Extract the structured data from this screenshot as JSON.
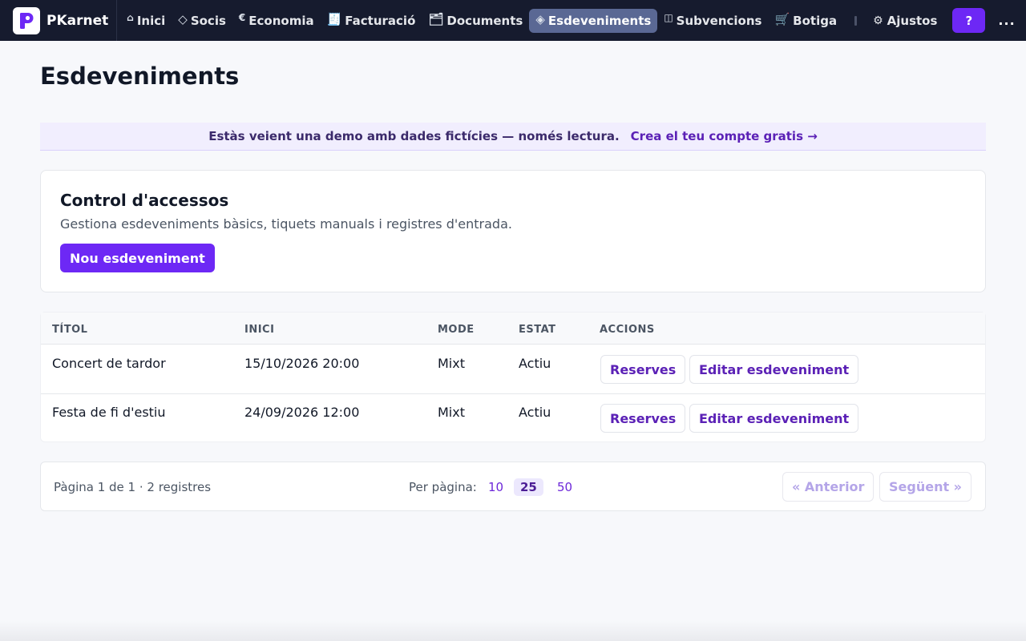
{
  "brand": {
    "name": "PKarnet",
    "logo_letter": "P"
  },
  "nav": {
    "items": [
      {
        "label": "Inici",
        "icon": "home-icon",
        "glyph": "⌂"
      },
      {
        "label": "Socis",
        "icon": "diamond-icon",
        "glyph": "◇"
      },
      {
        "label": "Economia",
        "icon": "euro-icon",
        "glyph": "€"
      },
      {
        "label": "Facturació",
        "icon": "receipt-icon",
        "glyph": "🧾"
      },
      {
        "label": "Documents",
        "icon": "folder-icon",
        "glyph": "🗂"
      },
      {
        "label": "Esdeveniments",
        "icon": "events-diamond-icon",
        "glyph": "◈",
        "active": true
      },
      {
        "label": "Subvencions",
        "icon": "columns-icon",
        "glyph": "◫"
      },
      {
        "label": "Botiga",
        "icon": "cart-icon",
        "glyph": "🛒"
      }
    ],
    "settings": {
      "label": "Ajustos",
      "glyph": "⚙"
    },
    "help_label": "?",
    "more_label": "..."
  },
  "page": {
    "title": "Esdeveniments"
  },
  "demo_banner": {
    "text": "Estàs veient una demo amb dades fictícies — només lectura.",
    "link": "Crea el teu compte gratis →"
  },
  "card": {
    "title": "Control d'accessos",
    "subtitle": "Gestiona esdeveniments bàsics, tiquets manuals i registres d'entrada.",
    "primary_button": "Nou esdeveniment"
  },
  "table": {
    "columns": [
      "TÍTOL",
      "INICI",
      "MODE",
      "ESTAT",
      "ACCIONS"
    ],
    "rows": [
      {
        "title": "Concert de tardor",
        "start": "15/10/2026 20:00",
        "mode": "Mixt",
        "status": "Actiu",
        "actions": [
          "Reserves",
          "Editar esdeveniment"
        ]
      },
      {
        "title": "Festa de fi d'estiu",
        "start": "24/09/2026 12:00",
        "mode": "Mixt",
        "status": "Actiu",
        "actions": [
          "Reserves",
          "Editar esdeveniment"
        ]
      }
    ]
  },
  "pager": {
    "info": "Pàgina 1 de 1 · 2 registres",
    "per_page_label": "Per pàgina:",
    "per_page_options": [
      "10",
      "25",
      "50"
    ],
    "per_page_selected": "25",
    "prev_label": "« Anterior",
    "next_label": "Següent »"
  },
  "colors": {
    "topbar": "#161b2e",
    "accent": "#6d28f5",
    "active_nav": "#5a6894",
    "link": "#5b21b6"
  }
}
